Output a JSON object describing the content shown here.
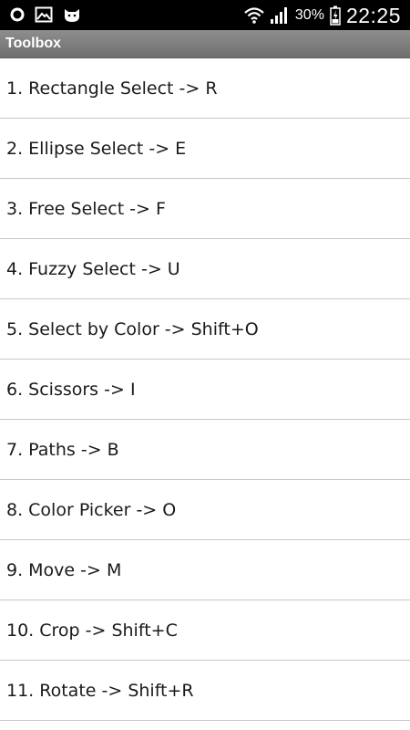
{
  "status_bar": {
    "left_icons": [
      "circle-icon",
      "gallery-icon",
      "cat-face-icon"
    ],
    "right_icons": [
      "wifi-icon",
      "signal-icon",
      "battery-icon"
    ],
    "battery_percent": "30%",
    "time": "22:25"
  },
  "title_bar": {
    "title": "Toolbox"
  },
  "list": {
    "items": [
      {
        "label": "1. Rectangle Select -> R"
      },
      {
        "label": "2. Ellipse Select -> E"
      },
      {
        "label": "3. Free Select -> F"
      },
      {
        "label": "4. Fuzzy Select -> U"
      },
      {
        "label": "5. Select by Color -> Shift+O"
      },
      {
        "label": "6. Scissors -> I"
      },
      {
        "label": "7. Paths -> B"
      },
      {
        "label": "8. Color Picker -> O"
      },
      {
        "label": "9. Move -> M"
      },
      {
        "label": "10. Crop -> Shift+C"
      },
      {
        "label": "11. Rotate -> Shift+R"
      }
    ]
  }
}
